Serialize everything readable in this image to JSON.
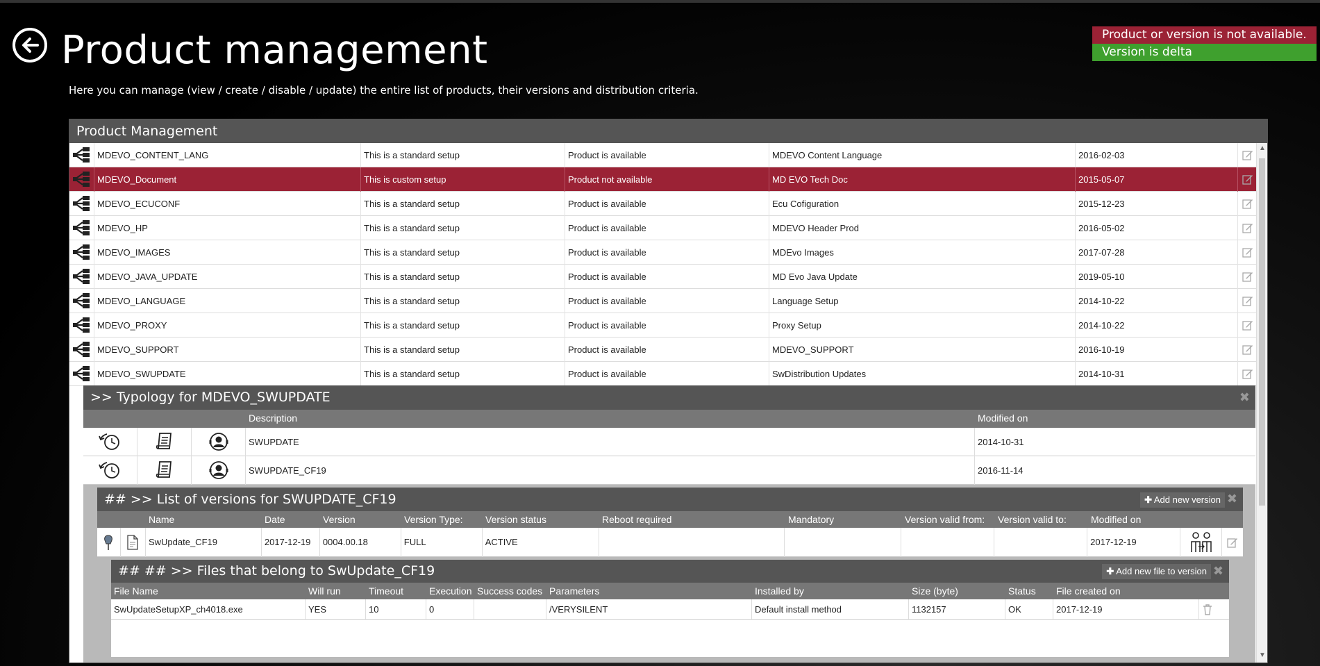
{
  "page": {
    "title": "Product management",
    "subtitle": "Here you can manage (view / create / disable / update) the entire list of products, their versions and distribution criteria."
  },
  "legend": {
    "not_available": "Product or version is not available.",
    "delta": "Version is delta",
    "colors": {
      "not_available": "#9b2235",
      "delta": "#3fa02e"
    }
  },
  "panel": {
    "title": "Product Management"
  },
  "products": [
    {
      "name": "MDEVO_CONTENT_LANG",
      "setup": "This is a standard setup",
      "availability": "Product is available",
      "label": "MDEVO Content Language",
      "date": "2016-02-03"
    },
    {
      "name": "MDEVO_Document",
      "setup": "This is custom setup",
      "availability": "Product not available",
      "label": "MD EVO Tech Doc",
      "date": "2015-05-07"
    },
    {
      "name": "MDEVO_ECUCONF",
      "setup": "This is a standard setup",
      "availability": "Product is available",
      "label": "Ecu Cofiguration",
      "date": "2015-12-23"
    },
    {
      "name": "MDEVO_HP",
      "setup": "This is a standard setup",
      "availability": "Product is available",
      "label": "MDEVO Header Prod",
      "date": "2016-05-02"
    },
    {
      "name": "MDEVO_IMAGES",
      "setup": "This is a standard setup",
      "availability": "Product is available",
      "label": "MDEvo Images",
      "date": "2017-07-28"
    },
    {
      "name": "MDEVO_JAVA_UPDATE",
      "setup": "This is a standard setup",
      "availability": "Product is available",
      "label": "MD Evo Java Update",
      "date": "2019-05-10"
    },
    {
      "name": "MDEVO_LANGUAGE",
      "setup": "This is a standard setup",
      "availability": "Product is available",
      "label": "Language Setup",
      "date": "2014-10-22"
    },
    {
      "name": "MDEVO_PROXY",
      "setup": "This is a standard setup",
      "availability": "Product is available",
      "label": "Proxy Setup",
      "date": "2014-10-22"
    },
    {
      "name": "MDEVO_SUPPORT",
      "setup": "This is a standard setup",
      "availability": "Product is available",
      "label": "MDEVO_SUPPORT",
      "date": "2016-10-19"
    },
    {
      "name": "MDEVO_SWUPDATE",
      "setup": "This is a standard setup",
      "availability": "Product is available",
      "label": "SwDistribution Updates",
      "date": "2014-10-31"
    }
  ],
  "typology": {
    "title": ">> Typology for MDEVO_SWUPDATE",
    "columns": {
      "description": "Description",
      "modified": "Modified on"
    },
    "rows": [
      {
        "description": "SWUPDATE",
        "modified": "2014-10-31"
      },
      {
        "description": "SWUPDATE_CF19",
        "modified": "2016-11-14"
      }
    ]
  },
  "versions": {
    "title": "## >> List of versions for SWUPDATE_CF19",
    "add_label": "Add new version",
    "columns": {
      "name": "Name",
      "date": "Date",
      "version": "Version",
      "type": "Version Type:",
      "status": "Version status",
      "reboot": "Reboot required",
      "mandatory": "Mandatory",
      "valid_from": "Version valid from:",
      "valid_to": "Version valid to:",
      "modified": "Modified on"
    },
    "row": {
      "name": "SwUpdate_CF19",
      "date": "2017-12-19",
      "version": "0004.00.18",
      "type": "FULL",
      "status": "ACTIVE",
      "reboot": "",
      "mandatory": "",
      "valid_from": "",
      "valid_to": "",
      "modified": "2017-12-19"
    }
  },
  "files": {
    "title": "## ## >> Files that belong to SwUpdate_CF19",
    "add_label": "Add new file to version",
    "columns": {
      "file_name": "File Name",
      "will_run": "Will run",
      "timeout": "Timeout",
      "execution": "Execution",
      "success": "Success codes",
      "parameters": "Parameters",
      "installed_by": "Installed by",
      "size": "Size (byte)",
      "status": "Status",
      "created": "File created on"
    },
    "row": {
      "file_name": "SwUpdateSetupXP_ch4018.exe",
      "will_run": "YES",
      "timeout": "10",
      "execution": "0",
      "success": "",
      "parameters": "/VERYSILENT",
      "installed_by": "Default install method",
      "size": "1132157",
      "status": "OK",
      "created": "2017-12-19"
    }
  }
}
